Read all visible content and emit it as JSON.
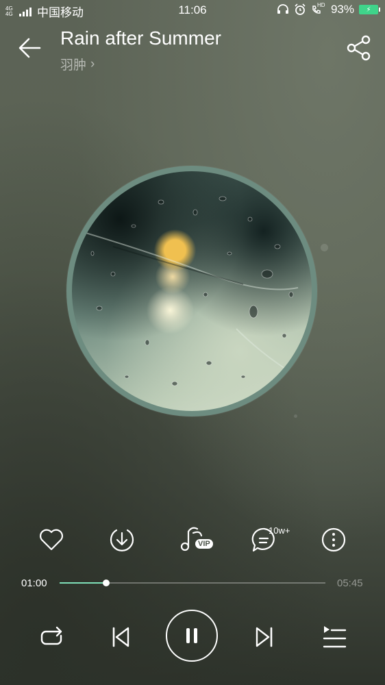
{
  "status_bar": {
    "network": "4G 4G",
    "carrier": "中国移动",
    "time": "11:06",
    "battery": "93%",
    "hd": "HD",
    "icons": [
      "headset-icon",
      "alarm-icon",
      "hd-call-icon",
      "battery-icon"
    ]
  },
  "header": {
    "title": "Rain after Summer",
    "artist": "羽肿",
    "artist_chevron": "›"
  },
  "actions": {
    "comment_count": "10w+",
    "vip_label": "VIP",
    "icons": [
      "heart-icon",
      "download-icon",
      "vip-sound-icon",
      "comment-icon",
      "more-icon"
    ]
  },
  "player": {
    "current_time": "01:00",
    "total_time": "05:45",
    "progress": 0.174,
    "state": "playing"
  },
  "controls": {
    "icons": [
      "repeat-icon",
      "previous-icon",
      "pause-icon",
      "next-icon",
      "playlist-icon"
    ]
  },
  "colors": {
    "accent": "#7fe0b8",
    "battery": "#3fd48a",
    "album_ring": "#6d8c80"
  }
}
